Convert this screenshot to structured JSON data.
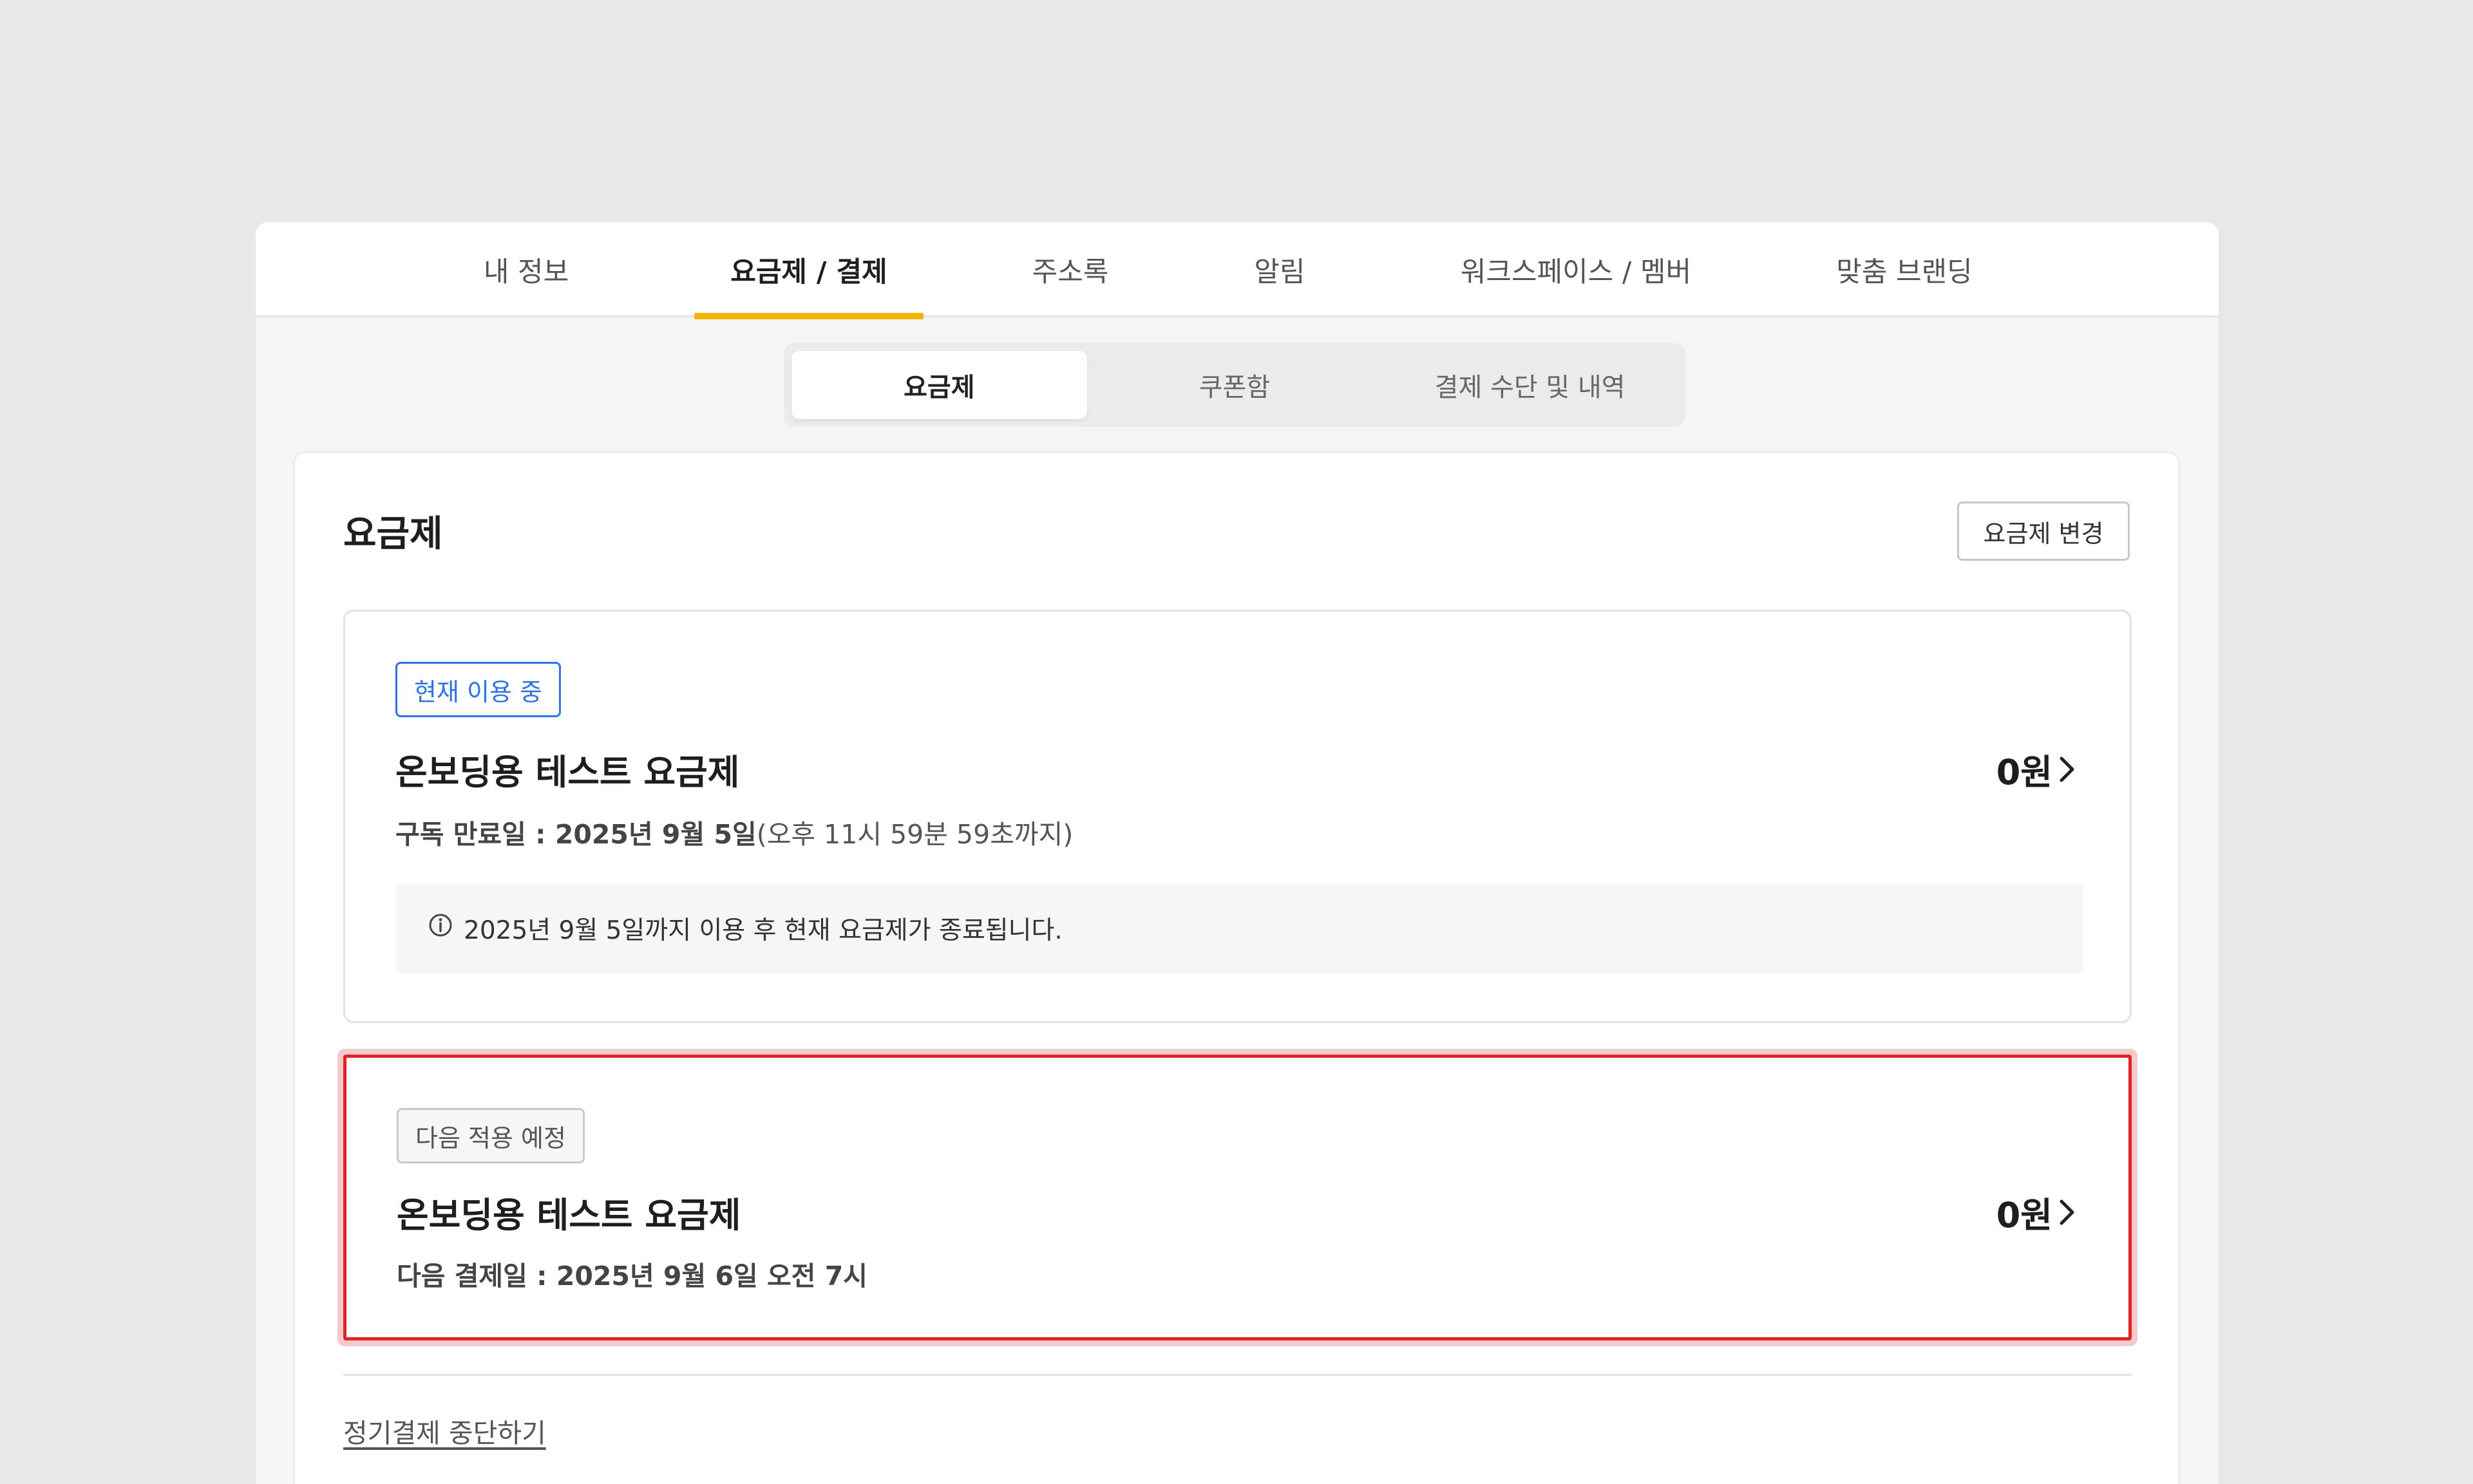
{
  "top_tabs": [
    {
      "label": "내 정보"
    },
    {
      "label": "요금제 / 결제"
    },
    {
      "label": "주소록"
    },
    {
      "label": "알림"
    },
    {
      "label": "워크스페이스 / 멤버"
    },
    {
      "label": "맞춤 브랜딩"
    }
  ],
  "sub_tabs": [
    {
      "label": "요금제"
    },
    {
      "label": "쿠폰함"
    },
    {
      "label": "결제 수단 및 내역"
    }
  ],
  "panel": {
    "title": "요금제",
    "change_button": "요금제 변경",
    "stop_link": "정기결제 중단하기"
  },
  "current_plan": {
    "badge": "현재 이용 중",
    "name": "온보딩용 테스트 요금제",
    "price": "0원",
    "expiry_label": "구독 만료일 : ",
    "expiry_date": "2025년 9월 5일",
    "expiry_time": "(오후 11시 59분 59초까지)",
    "notice": "2025년 9월 5일까지 이용 후 현재 요금제가 종료됩니다."
  },
  "next_plan": {
    "badge": "다음 적용 예정",
    "name": "온보딩용 테스트 요금제",
    "price": "0원",
    "next_payment_label": "다음 결제일 : ",
    "next_payment_date": "2025년 9월 6일 오전 7시"
  },
  "colors": {
    "accent": "#f5b400",
    "badge_blue": "#2f73e0",
    "highlight_red": "#e0232b"
  }
}
